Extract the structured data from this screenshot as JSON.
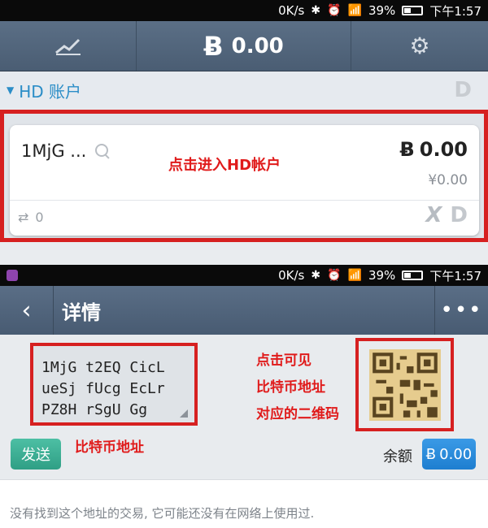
{
  "status_bar": {
    "speed": "0K/s",
    "battery": "39%",
    "time": "下午1:57",
    "network": "3G"
  },
  "wallet_header": {
    "balance": "0.00",
    "btc_symbol": "Ƀ"
  },
  "hd_section": {
    "label": "HD 账户",
    "right_letter": "D"
  },
  "account_card": {
    "address": "1MjG ...",
    "btc_balance": "0.00",
    "fiat_balance": "¥0.00",
    "tx_count": "0",
    "annotation": "点击进入HD帐户"
  },
  "details_screen": {
    "back": "‹",
    "title": "详情",
    "more": "•••",
    "address_lines": [
      "1MjG t2EQ CicL",
      "ueSj fUcg EcLr",
      "PZ8H rSgU Gg"
    ],
    "address_annotation": "比特币地址",
    "qr_annotation": [
      "点击可见",
      "比特币地址",
      "对应的二维码"
    ],
    "send_button": "发送",
    "balance_label": "余额",
    "balance_value": "0.00",
    "no_tx_message": "没有找到这个地址的交易, 它可能还没有在网络上使用过."
  }
}
